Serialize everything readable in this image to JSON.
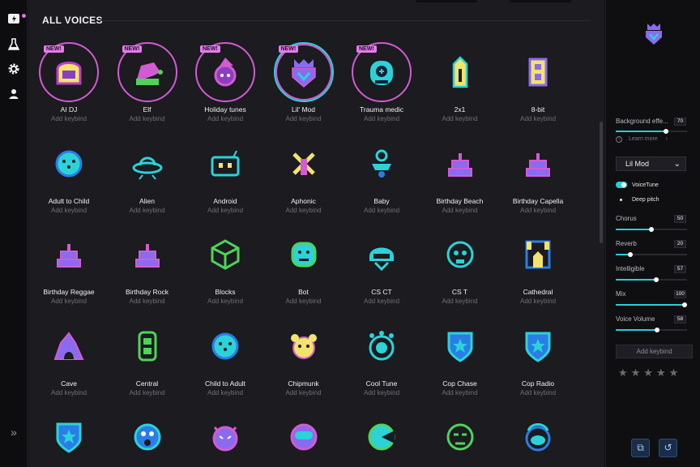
{
  "section_title": "ALL VOICES",
  "badge_text": "NEW!",
  "voices": [
    {
      "name": "AI DJ",
      "keybind": "Add keybind",
      "icon": "helmet-icon",
      "new": true
    },
    {
      "name": "Elf",
      "keybind": "Add keybind",
      "icon": "elf-hat-icon",
      "new": true
    },
    {
      "name": "Holiday tunes",
      "keybind": "Add keybind",
      "icon": "holiday-face-icon",
      "new": true
    },
    {
      "name": "Lil' Mod",
      "keybind": "Add keybind",
      "icon": "crown-shield-icon",
      "new": true,
      "selected": true
    },
    {
      "name": "Trauma medic",
      "keybind": "Add keybind",
      "icon": "medic-mask-icon",
      "new": true
    },
    {
      "name": "2x1",
      "keybind": "Add keybind",
      "icon": "pencil-tag-icon"
    },
    {
      "name": "8-bit",
      "keybind": "Add keybind",
      "icon": "eight-bit-icon"
    },
    {
      "name": "Adult to Child",
      "keybind": "Add keybind",
      "icon": "face-dots-icon"
    },
    {
      "name": "Alien",
      "keybind": "Add keybind",
      "icon": "ufo-icon"
    },
    {
      "name": "Android",
      "keybind": "Add keybind",
      "icon": "robot-icon"
    },
    {
      "name": "Aphonic",
      "keybind": "Add keybind",
      "icon": "muted-mic-icon"
    },
    {
      "name": "Baby",
      "keybind": "Add keybind",
      "icon": "pacifier-icon"
    },
    {
      "name": "Birthday Beach",
      "keybind": "Add keybind",
      "icon": "cake-icon"
    },
    {
      "name": "Birthday Capella",
      "keybind": "Add keybind",
      "icon": "cake-icon"
    },
    {
      "name": "Birthday Reggae",
      "keybind": "Add keybind",
      "icon": "cake-icon"
    },
    {
      "name": "Birthday Rock",
      "keybind": "Add keybind",
      "icon": "cake-icon"
    },
    {
      "name": "Blocks",
      "keybind": "Add keybind",
      "icon": "cube-icon"
    },
    {
      "name": "Bot",
      "keybind": "Add keybind",
      "icon": "bot-face-icon"
    },
    {
      "name": "CS CT",
      "keybind": "Add keybind",
      "icon": "ct-helmet-icon"
    },
    {
      "name": "CS T",
      "keybind": "Add keybind",
      "icon": "balaclava-icon"
    },
    {
      "name": "Cathedral",
      "keybind": "Add keybind",
      "icon": "cathedral-icon"
    },
    {
      "name": "Cave",
      "keybind": "Add keybind",
      "icon": "cave-icon"
    },
    {
      "name": "Central",
      "keybind": "Add keybind",
      "icon": "phone-icon"
    },
    {
      "name": "Child to Adult",
      "keybind": "Add keybind",
      "icon": "face-dots-icon"
    },
    {
      "name": "Chipmunk",
      "keybind": "Add keybind",
      "icon": "chipmunk-icon"
    },
    {
      "name": "Cool Tune",
      "keybind": "Add keybind",
      "icon": "knob-icon"
    },
    {
      "name": "Cop Chase",
      "keybind": "Add keybind",
      "icon": "badge-shield-icon"
    },
    {
      "name": "Cop Radio",
      "keybind": "Add keybind",
      "icon": "badge-shield-icon"
    },
    {
      "name": "",
      "keybind": "",
      "icon": "badge-shield-icon"
    },
    {
      "name": "",
      "keybind": "",
      "icon": "scared-face-icon"
    },
    {
      "name": "",
      "keybind": "",
      "icon": "demon-face-icon"
    },
    {
      "name": "",
      "keybind": "",
      "icon": "diver-face-icon"
    },
    {
      "name": "",
      "keybind": "",
      "icon": "pac-face-icon"
    },
    {
      "name": "",
      "keybind": "",
      "icon": "tired-face-icon"
    },
    {
      "name": "",
      "keybind": "",
      "icon": "alien-bald-icon"
    }
  ],
  "panel": {
    "background_effect_label": "Background effe...",
    "background_effect_value": "70",
    "background_effect_level": 0.7,
    "learn_more": "Learn more",
    "selected_voice": "Lil Mod",
    "voicetune_label": "VoiceTune",
    "deep_pitch_label": "Deep pitch",
    "params": [
      {
        "label": "Chorus",
        "value": "50",
        "level": 0.5
      },
      {
        "label": "Reverb",
        "value": "20",
        "level": 0.2
      },
      {
        "label": "Intelligible",
        "value": "57",
        "level": 0.57
      },
      {
        "label": "Mix",
        "value": "100",
        "level": 1.0
      },
      {
        "label": "Voice Volume",
        "value": "58",
        "level": 0.58
      }
    ],
    "add_keybind": "Add keybind",
    "rating_stars": "★★★★★",
    "copy_label": "⧉",
    "reset_label": "↺"
  },
  "colors": {
    "cyan": "#2bd3d8",
    "magenta": "#d35ad3",
    "violet": "#8a6bf0",
    "yellow": "#f3e36b",
    "green": "#4fd35a",
    "blue": "#2a7de6"
  }
}
